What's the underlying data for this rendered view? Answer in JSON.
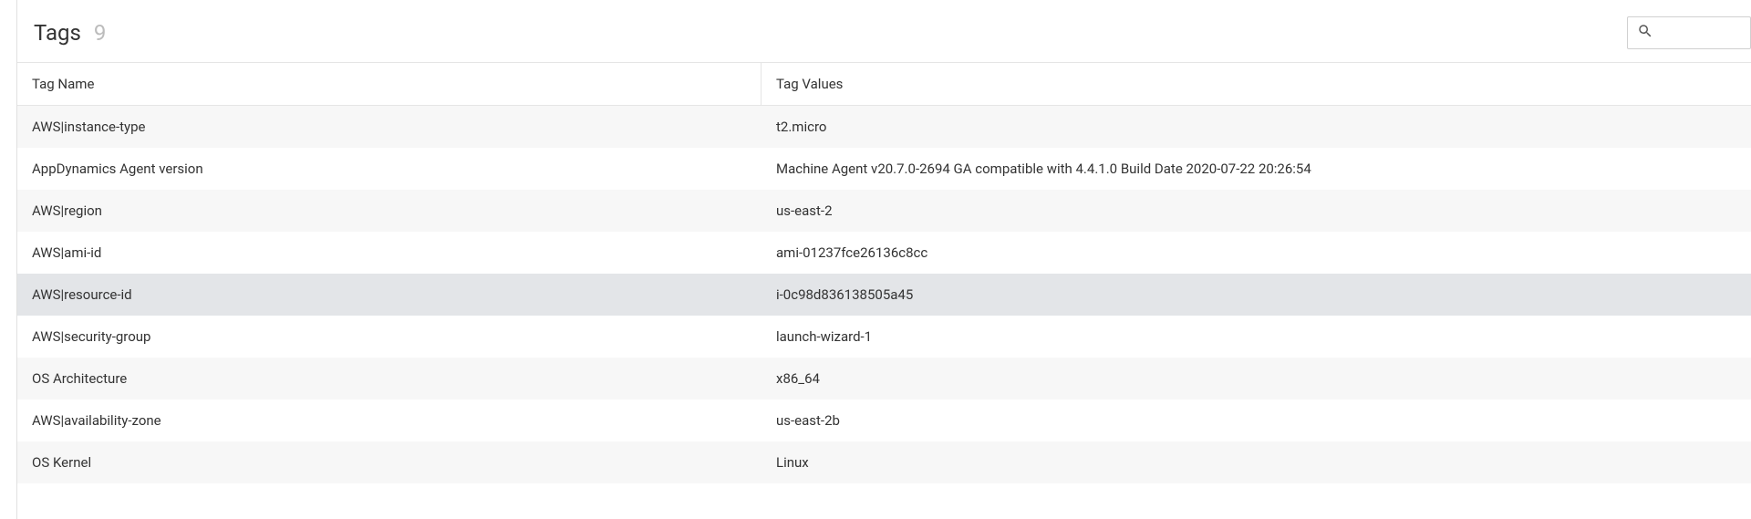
{
  "header": {
    "title": "Tags",
    "count": "9"
  },
  "search": {
    "value": "",
    "placeholder": ""
  },
  "table": {
    "columns": {
      "name": "Tag Name",
      "value": "Tag Values"
    },
    "rows": [
      {
        "name": "AWS|instance-type",
        "value": "t2.micro",
        "selected": false
      },
      {
        "name": "AppDynamics Agent version",
        "value": "Machine Agent v20.7.0-2694 GA compatible with 4.4.1.0 Build Date 2020-07-22 20:26:54",
        "selected": false
      },
      {
        "name": "AWS|region",
        "value": "us-east-2",
        "selected": false
      },
      {
        "name": "AWS|ami-id",
        "value": "ami-01237fce26136c8cc",
        "selected": false
      },
      {
        "name": "AWS|resource-id",
        "value": "i-0c98d836138505a45",
        "selected": true
      },
      {
        "name": "AWS|security-group",
        "value": "launch-wizard-1",
        "selected": false
      },
      {
        "name": "OS Architecture",
        "value": "x86_64",
        "selected": false
      },
      {
        "name": "AWS|availability-zone",
        "value": "us-east-2b",
        "selected": false
      },
      {
        "name": "OS Kernel",
        "value": "Linux",
        "selected": false
      }
    ]
  }
}
